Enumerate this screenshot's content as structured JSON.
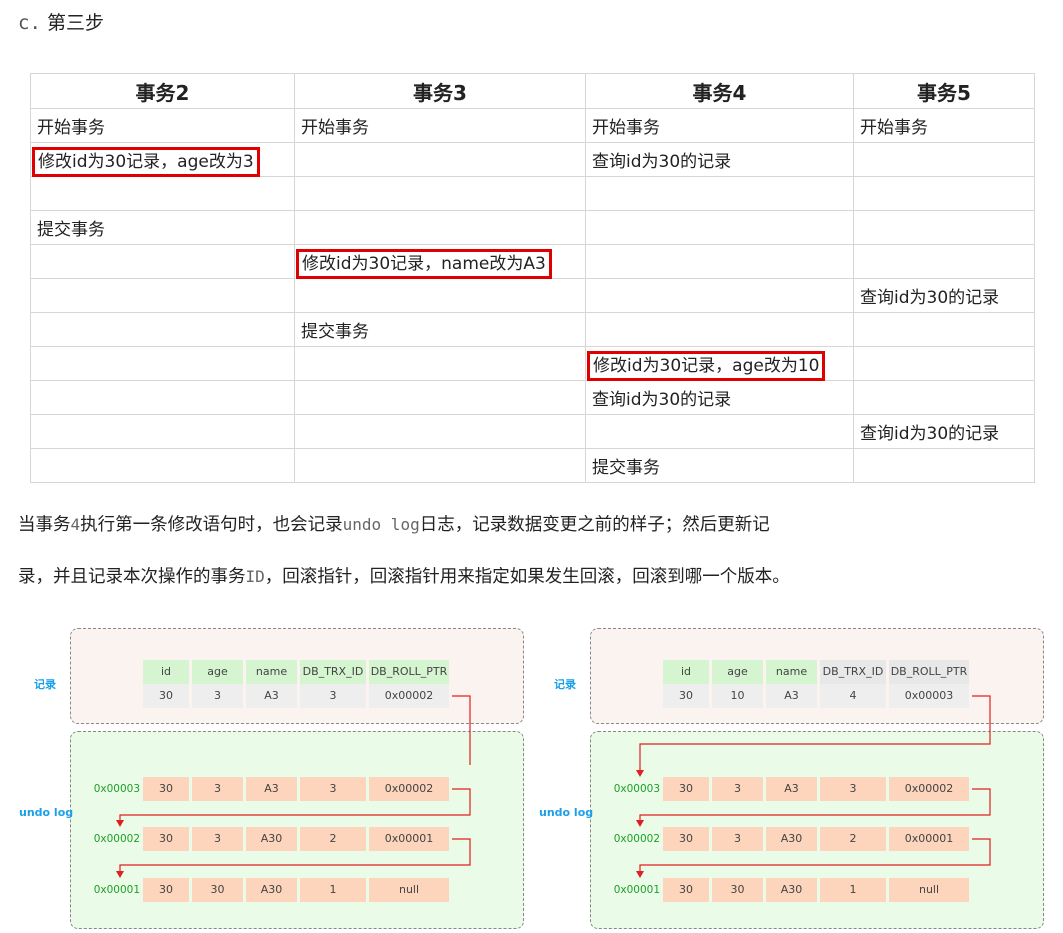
{
  "heading": {
    "prefix": "c.",
    "text": "第三步"
  },
  "table": {
    "headers": [
      "事务2",
      "事务3",
      "事务4",
      "事务5"
    ],
    "rows": [
      [
        "开始事务",
        "开始事务",
        "开始事务",
        "开始事务"
      ],
      [
        "修改id为30记录，age改为3",
        "",
        "查询id为30的记录",
        ""
      ],
      [
        "",
        "",
        "",
        ""
      ],
      [
        "提交事务",
        "",
        "",
        ""
      ],
      [
        "",
        "修改id为30记录，name改为A3",
        "",
        ""
      ],
      [
        "",
        "",
        "",
        "查询id为30的记录"
      ],
      [
        "",
        "提交事务",
        "",
        ""
      ],
      [
        "",
        "",
        "修改id为30记录，age改为10",
        ""
      ],
      [
        "",
        "",
        "查询id为30的记录",
        ""
      ],
      [
        "",
        "",
        "",
        "查询id为30的记录"
      ],
      [
        "",
        "",
        "提交事务",
        ""
      ]
    ],
    "highlighted": [
      "1-0",
      "4-1",
      "7-2"
    ]
  },
  "paragraph": {
    "line1_a": "当事务",
    "line1_b": "4",
    "line1_c": "执行第一条修改语句时，也会记录",
    "line1_d": "undo log",
    "line1_e": "日志，记录数据变更之前的样子；然后更新记",
    "line2_a": "录，并且记录本次操作的事务",
    "line2_b": "ID",
    "line2_c": "，回滚指针，回滚指针用来指定如果发生回滚，回滚到哪一个版本。"
  },
  "diagrams": {
    "record_label": "记录",
    "undo_label": "undo log",
    "columns": [
      "id",
      "age",
      "name",
      "DB_TRX_ID",
      "DB_ROLL_PTR"
    ],
    "left": {
      "record": [
        "30",
        "3",
        "A3",
        "3",
        "0x00002"
      ],
      "undo": [
        {
          "addr": "0x00003",
          "values": [
            "30",
            "3",
            "A3",
            "3",
            "0x00002"
          ]
        },
        {
          "addr": "0x00002",
          "values": [
            "30",
            "3",
            "A30",
            "2",
            "0x00001"
          ]
        },
        {
          "addr": "0x00001",
          "values": [
            "30",
            "30",
            "A30",
            "1",
            "null"
          ]
        }
      ]
    },
    "right": {
      "record": [
        "30",
        "10",
        "A3",
        "4",
        "0x00003"
      ],
      "undo": [
        {
          "addr": "0x00003",
          "values": [
            "30",
            "3",
            "A3",
            "3",
            "0x00002"
          ]
        },
        {
          "addr": "0x00002",
          "values": [
            "30",
            "3",
            "A30",
            "2",
            "0x00001"
          ]
        },
        {
          "addr": "0x00001",
          "values": [
            "30",
            "30",
            "A30",
            "1",
            "null"
          ]
        }
      ]
    },
    "colors": {
      "arrow": "#e02020",
      "label": "#1aa0e8",
      "addr": "#1f9f2a",
      "peach": "#fcd5bc",
      "green_header": "#d5f4d0"
    }
  }
}
